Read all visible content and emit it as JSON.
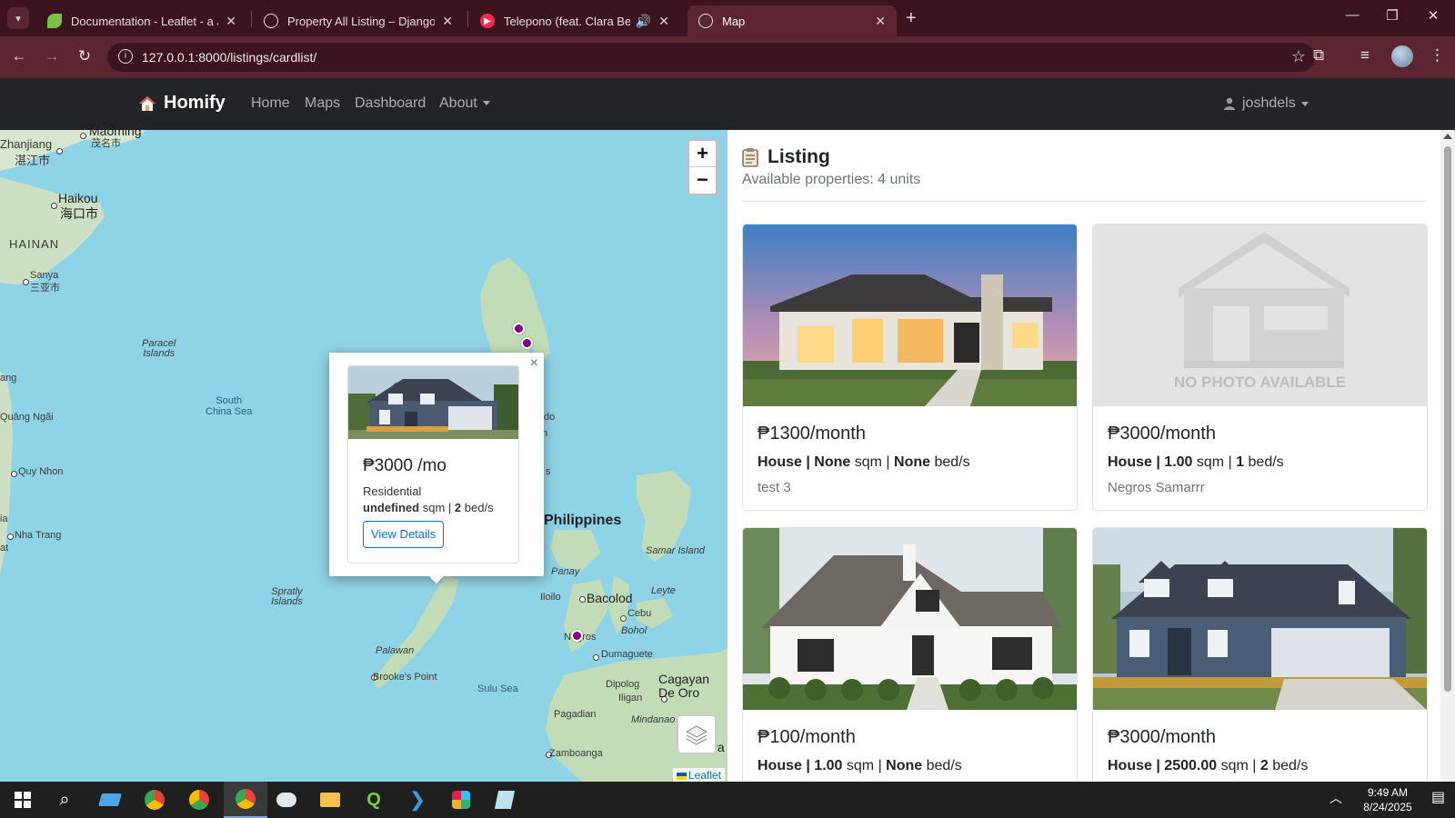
{
  "browser": {
    "tabs": [
      {
        "title": "Documentation - Leaflet - a Jav",
        "active": false
      },
      {
        "title": "Property All Listing – Django RE",
        "active": false
      },
      {
        "title": "Telepono (feat. Clara Benin)",
        "active": false
      },
      {
        "title": "Map",
        "active": true
      }
    ],
    "url": "127.0.0.1:8000/listings/cardlist/"
  },
  "site": {
    "brand": "Homify",
    "nav": {
      "home": "Home",
      "maps": "Maps",
      "dashboard": "Dashboard",
      "about": "About"
    },
    "user": "joshdels"
  },
  "map": {
    "labels": {
      "maoming": "Maoming",
      "maoming_cn": "茂名市",
      "zhanjiang": "Zhanjiang",
      "zhanjiang_cn": "湛江市",
      "haikou": "Haikou",
      "haikou_cn": "海口市",
      "hainan": "HAINAN",
      "sanya": "Sanya",
      "sanya_cn": "三亚市",
      "paracel": "Paracel\nIslands",
      "south_china_sea": "South\nChina Sea",
      "ang": "ang",
      "quang_ngai": "Quảng Ngãi",
      "quy_nhon": "Quy Nhon",
      "nha_trang": "Nha Trang",
      "at": "at",
      "ia": "ia",
      "spratly": "Spratly\nIslands",
      "palawan": "Palawan",
      "brookes_point": "Brooke's Point",
      "sulu_sea": "Sulu Sea",
      "philippines": "Philippines",
      "samar": "Samar Island",
      "panay": "Panay",
      "leyte": "Leyte",
      "iloilo": "Iloilo",
      "bacolod": "Bacolod",
      "cebu": "Cebu",
      "bohol": "Bohol",
      "negros": "Negros",
      "dumaguete": "Dumaguete",
      "dipolog": "Dipolog",
      "iligan": "Iligan",
      "cagayan": "Cagayan\nDe Oro",
      "pagadian": "Pagadian",
      "mindanao": "Mindanao",
      "zamboanga": "Zamboanga",
      "davao": "Dava",
      "do": "do",
      "n": "n",
      "s": "s"
    },
    "attribution": "Leaflet",
    "popup": {
      "price": "₱3000 /mo",
      "type": "Residential",
      "area_value": "undefined",
      "area_unit": "sqm |",
      "beds_value": "2",
      "beds_unit": "bed/s",
      "button": "View Details"
    }
  },
  "listing": {
    "title": "Listing",
    "subtitle": "Available properties: 4 units",
    "cards": [
      {
        "price": "₱1300/month",
        "type": "House",
        "area": "None",
        "beds": "None",
        "location": "test 3",
        "image": "modern-house-photo"
      },
      {
        "price": "₱3000/month",
        "type": "House",
        "area": "1.00",
        "beds": "1",
        "location": "Negros Samarrr",
        "image": "no-photo",
        "no_photo_text": "NO PHOTO AVAILABLE"
      },
      {
        "price": "₱100/month",
        "type": "House",
        "area": "1.00",
        "beds": "None",
        "location": "",
        "image": "white-farmhouse-photo"
      },
      {
        "price": "₱3000/month",
        "type": "House",
        "area": "2500.00",
        "beds": "2",
        "location": "",
        "image": "blue-house-photo"
      }
    ],
    "labels": {
      "sqm": "sqm |",
      "beds": "bed/s",
      "sep": "|"
    }
  },
  "taskbar": {
    "time": "9:49 AM",
    "date": "8/24/2025"
  },
  "colors": {
    "marker": "#800080",
    "navbar": "#212529",
    "tab_bar": "#3c1420",
    "address_bar": "#5b2532",
    "sea": "#8fd3e6",
    "link": "#0d6efd"
  }
}
